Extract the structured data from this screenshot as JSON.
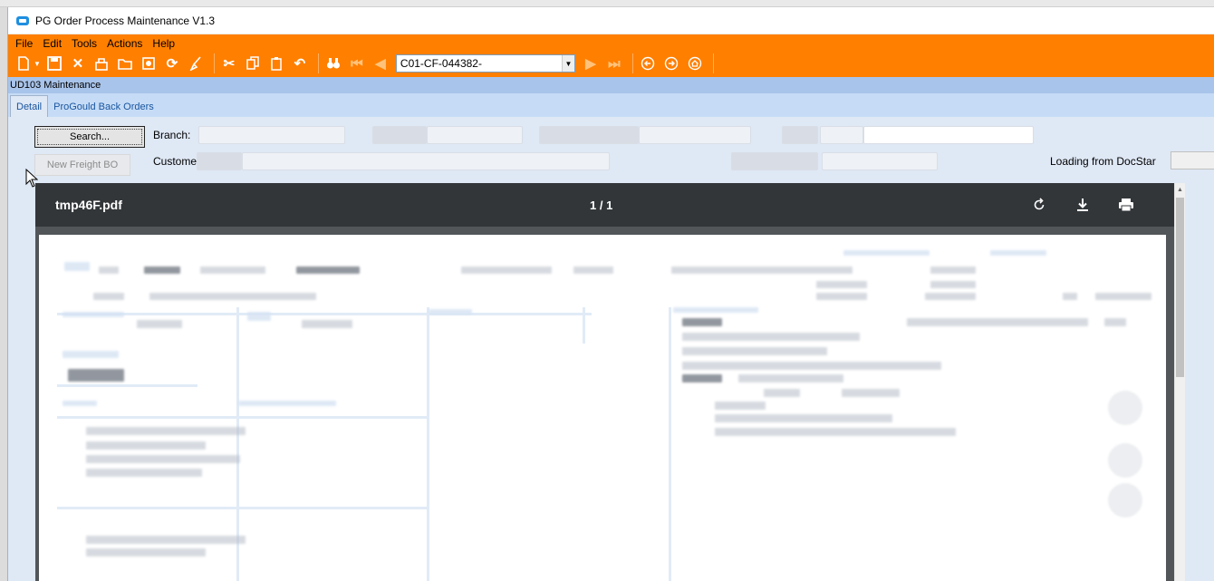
{
  "window": {
    "title": "PG Order Process Maintenance V1.3"
  },
  "menu": [
    "File",
    "Edit",
    "Tools",
    "Actions",
    "Help"
  ],
  "toolbar": {
    "record_combo_value": "C01-CF-044382-",
    "icons": [
      "new-icon",
      "save-icon",
      "delete-icon",
      "clear-icon",
      "open-icon",
      "print-preview-icon",
      "refresh-icon",
      "cleanup-icon",
      "cut-icon",
      "copy-icon",
      "paste-icon",
      "undo-icon",
      "binoculars-icon",
      "first-record-icon",
      "previous-record-icon",
      "next-record-icon",
      "last-record-icon",
      "back-icon",
      "forward-icon",
      "home-icon"
    ]
  },
  "form": {
    "title": "UD103 Maintenance"
  },
  "tabs": [
    "Detail",
    "ProGould Back Orders"
  ],
  "fields": {
    "search_button": "Search...",
    "branch_label": "Branch:",
    "new_freight_button": "New Freight BO",
    "customer_label": "Custome",
    "loading_label": "Loading from DocStar"
  },
  "viewer": {
    "filename": "tmp46F.pdf",
    "page_indicator": "1 / 1"
  },
  "colors": {
    "accent": "#ff7f00",
    "form_bg": "#dfe8f5",
    "viewer_bar": "#323639"
  }
}
